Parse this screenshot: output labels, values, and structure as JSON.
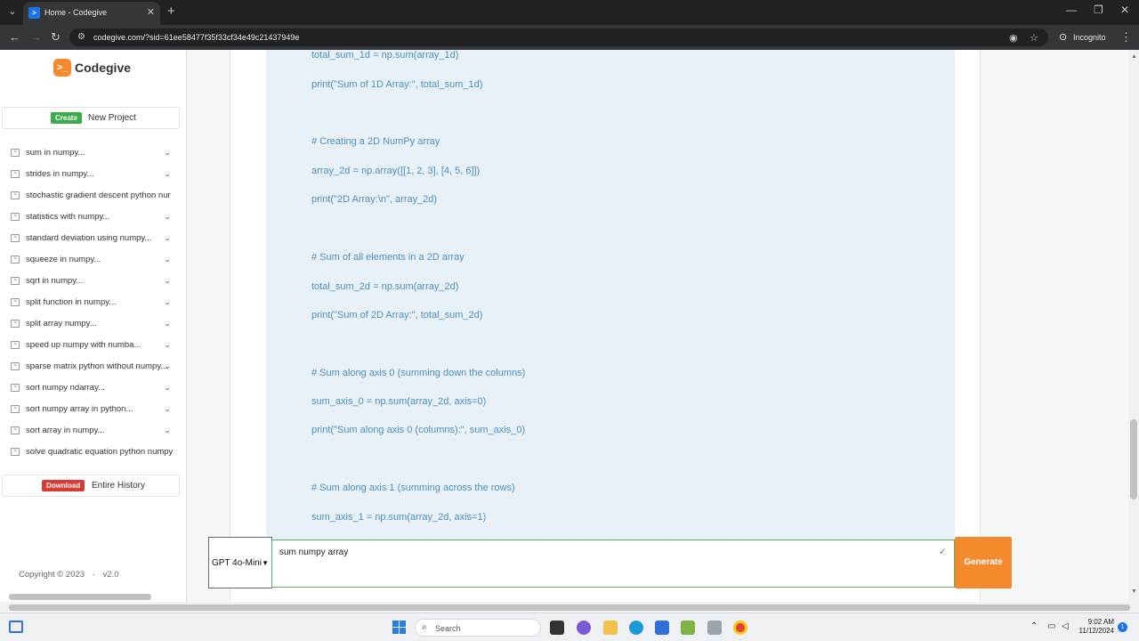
{
  "browser": {
    "tab_title": "Home - Codegive",
    "new_tab_symbol": "+",
    "url": "codegive.com/?sid=61ee58477f35f33cf34e49c21437949e",
    "incognito_label": "Incognito"
  },
  "sidebar": {
    "logo_text": "Codegive",
    "create": {
      "badge": "Create",
      "label": "New Project"
    },
    "history": [
      {
        "label": "sum in numpy...",
        "chevron": true
      },
      {
        "label": "strides in numpy...",
        "chevron": true
      },
      {
        "label": "stochastic gradient descent python nur",
        "chevron": false
      },
      {
        "label": "statistics with numpy...",
        "chevron": true
      },
      {
        "label": "standard deviation using numpy...",
        "chevron": true
      },
      {
        "label": "squeeze in numpy...",
        "chevron": true
      },
      {
        "label": "sqrt in numpy...",
        "chevron": true
      },
      {
        "label": "split function in numpy...",
        "chevron": true
      },
      {
        "label": "split array numpy...",
        "chevron": true
      },
      {
        "label": "speed up numpy with numba...",
        "chevron": true
      },
      {
        "label": "sparse matrix python without numpy...",
        "chevron": true
      },
      {
        "label": "sort numpy ndarray...",
        "chevron": true
      },
      {
        "label": "sort numpy array in python...",
        "chevron": true
      },
      {
        "label": "sort array in numpy...",
        "chevron": true
      },
      {
        "label": "solve quadratic equation python numpy",
        "chevron": false
      }
    ],
    "download": {
      "badge": "Download",
      "label": "Entire History"
    },
    "copyright": "Copyright © 2023",
    "separator": "·",
    "version": "v2.0"
  },
  "code": {
    "lines": [
      "total_sum_1d = np.sum(array_1d)",
      "print(\"Sum of 1D Array:\", total_sum_1d)",
      "# Creating a 2D NumPy array",
      "array_2d = np.array([[1, 2, 3], [4, 5, 6]])",
      "print(\"2D Array:\\n\", array_2d)",
      "# Sum of all elements in a 2D array",
      "total_sum_2d = np.sum(array_2d)",
      "print(\"Sum of 2D Array:\", total_sum_2d)",
      "# Sum along axis 0 (summing down the columns)",
      "sum_axis_0 = np.sum(array_2d, axis=0)",
      "print(\"Sum along axis 0 (columns):\", sum_axis_0)",
      "# Sum along axis 1 (summing across the rows)",
      "sum_axis_1 = np.sum(array_2d, axis=1)"
    ]
  },
  "prompt": {
    "model": "GPT 4o-Mini",
    "text": "sum numpy array",
    "generate_label": "Generate"
  },
  "taskbar": {
    "search_label": "Search",
    "time": "9:02 AM",
    "date": "11/12/2024",
    "notification_count": "1"
  }
}
